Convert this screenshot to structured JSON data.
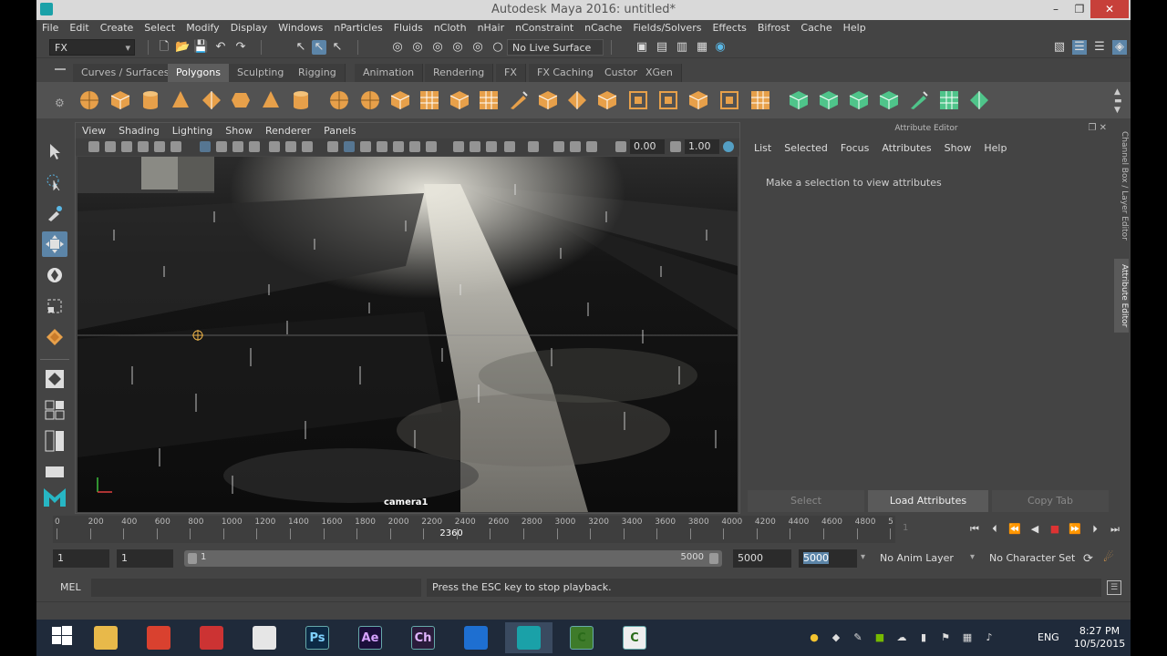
{
  "window": {
    "title": "Autodesk Maya 2016: untitled*"
  },
  "menubar": [
    "File",
    "Edit",
    "Create",
    "Select",
    "Modify",
    "Display",
    "Windows",
    "nParticles",
    "Fluids",
    "nCloth",
    "nHair",
    "nConstraint",
    "nCache",
    "Fields/Solvers",
    "Effects",
    "Bifrost",
    "Cache",
    "Help"
  ],
  "statusline": {
    "menuset": "FX",
    "live_surface": "No Live Surface"
  },
  "shelf_tabs": [
    "Curves / Surfaces",
    "Polygons",
    "Sculpting",
    "Rigging",
    "Animation",
    "Rendering",
    "FX",
    "FX Caching",
    "Custom",
    "XGen"
  ],
  "shelf_active": "Polygons",
  "panel": {
    "menus": [
      "View",
      "Shading",
      "Lighting",
      "Show",
      "Renderer",
      "Panels"
    ],
    "exposure": "0.00",
    "gamma": "1.00",
    "camera": "camera1"
  },
  "attribute_editor": {
    "header": "Attribute Editor",
    "menus": [
      "List",
      "Selected",
      "Focus",
      "Attributes",
      "Show",
      "Help"
    ],
    "message": "Make a selection to view attributes",
    "buttons": [
      "Select",
      "Load Attributes",
      "Copy Tab"
    ]
  },
  "side_tabs": [
    "Channel Box / Layer Editor",
    "Attribute Editor"
  ],
  "timeline": {
    "ticks": [
      "0",
      "200",
      "400",
      "600",
      "800",
      "1000",
      "1200",
      "1400",
      "1600",
      "1800",
      "2000",
      "2200",
      "2400",
      "2600",
      "2800",
      "3000",
      "3200",
      "3400",
      "3600",
      "3800",
      "4000",
      "4200",
      "4400",
      "4600",
      "4800",
      "5"
    ],
    "current_frame": "2360",
    "current_frame_fraction": 0.472,
    "small_field": "1"
  },
  "range": {
    "start": "1",
    "playback_start": "1",
    "bar_start": "1",
    "bar_end": "5000",
    "playback_end": "5000",
    "end": "5000",
    "anim_layer": "No Anim Layer",
    "character_set": "No Character Set"
  },
  "cmdline": {
    "label": "MEL",
    "feedback": "Press the ESC key to stop playback."
  },
  "taskbar": {
    "apps": [
      {
        "name": "windows-start",
        "glyph": "",
        "color": "#ffffff"
      },
      {
        "name": "file-explorer",
        "glyph": "",
        "color": "#e8b94a"
      },
      {
        "name": "chrome",
        "glyph": "",
        "color": "#d9412f"
      },
      {
        "name": "app-red",
        "glyph": "",
        "color": "#c33"
      },
      {
        "name": "app-camera",
        "glyph": "",
        "color": "#e6e6e6"
      },
      {
        "name": "photoshop",
        "glyph": "Ps",
        "color": "#0c2a45"
      },
      {
        "name": "after-effects",
        "glyph": "Ae",
        "color": "#1b0f3a"
      },
      {
        "name": "character-animator",
        "glyph": "Ch",
        "color": "#2a1c3b"
      },
      {
        "name": "mail",
        "glyph": "",
        "color": "#1e6fd1"
      },
      {
        "name": "maya",
        "glyph": "",
        "color": "#1aa1a8"
      },
      {
        "name": "camtasia-1",
        "glyph": "C",
        "color": "#3e7b2a"
      },
      {
        "name": "camtasia-2",
        "glyph": "C",
        "color": "#eeeeee"
      }
    ],
    "language": "ENG",
    "time": "8:27 PM",
    "date": "10/5/2015"
  }
}
